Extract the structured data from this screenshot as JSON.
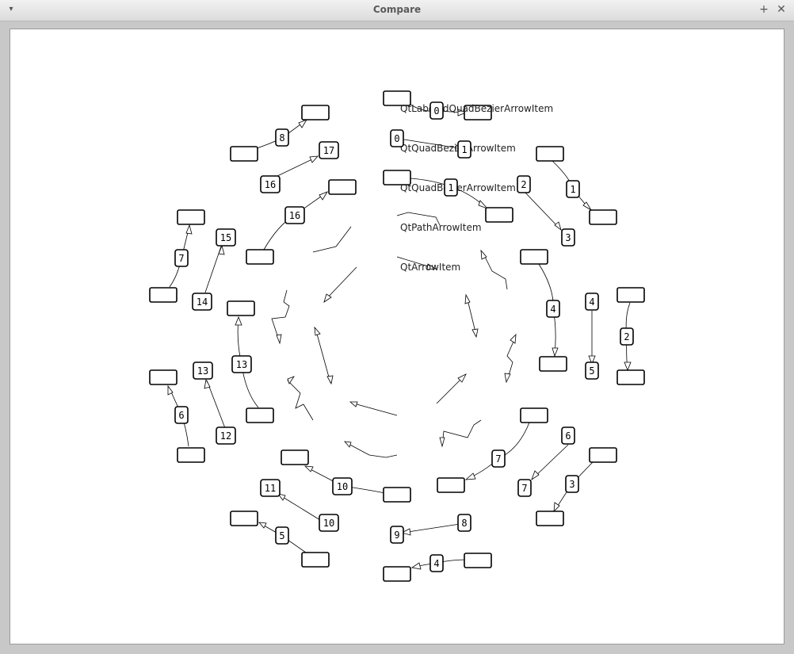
{
  "window": {
    "title": "Compare",
    "menu_glyph": "▾",
    "maximize_glyph": "+",
    "close_glyph": "✕"
  },
  "legend": [
    "QtLabeledQuadBezierArrowItem",
    "QtQuadBezierArrowItem",
    "QtQuadBezierArrowItem",
    "QtPathArrowItem",
    "QtArrowItem"
  ],
  "labels": {
    "a0": "0",
    "b0": "0",
    "b1": "1",
    "c1": "1",
    "d1": "1",
    "d2": "2",
    "d3": "3",
    "d4": "4",
    "d5": "5",
    "d6": "6",
    "d7": "7",
    "d8": "8",
    "d9": "9",
    "e2": "2",
    "e3": "3",
    "e4": "4",
    "e5": "5",
    "e6": "6",
    "e7": "7",
    "e8": "8",
    "f10": "10",
    "f11": "11",
    "f12": "12",
    "f13": "13",
    "f14": "14",
    "f15": "15",
    "f16": "16",
    "f17": "17",
    "g4": "4",
    "g7": "7",
    "g10": "10",
    "g13": "13",
    "g16": "16"
  }
}
